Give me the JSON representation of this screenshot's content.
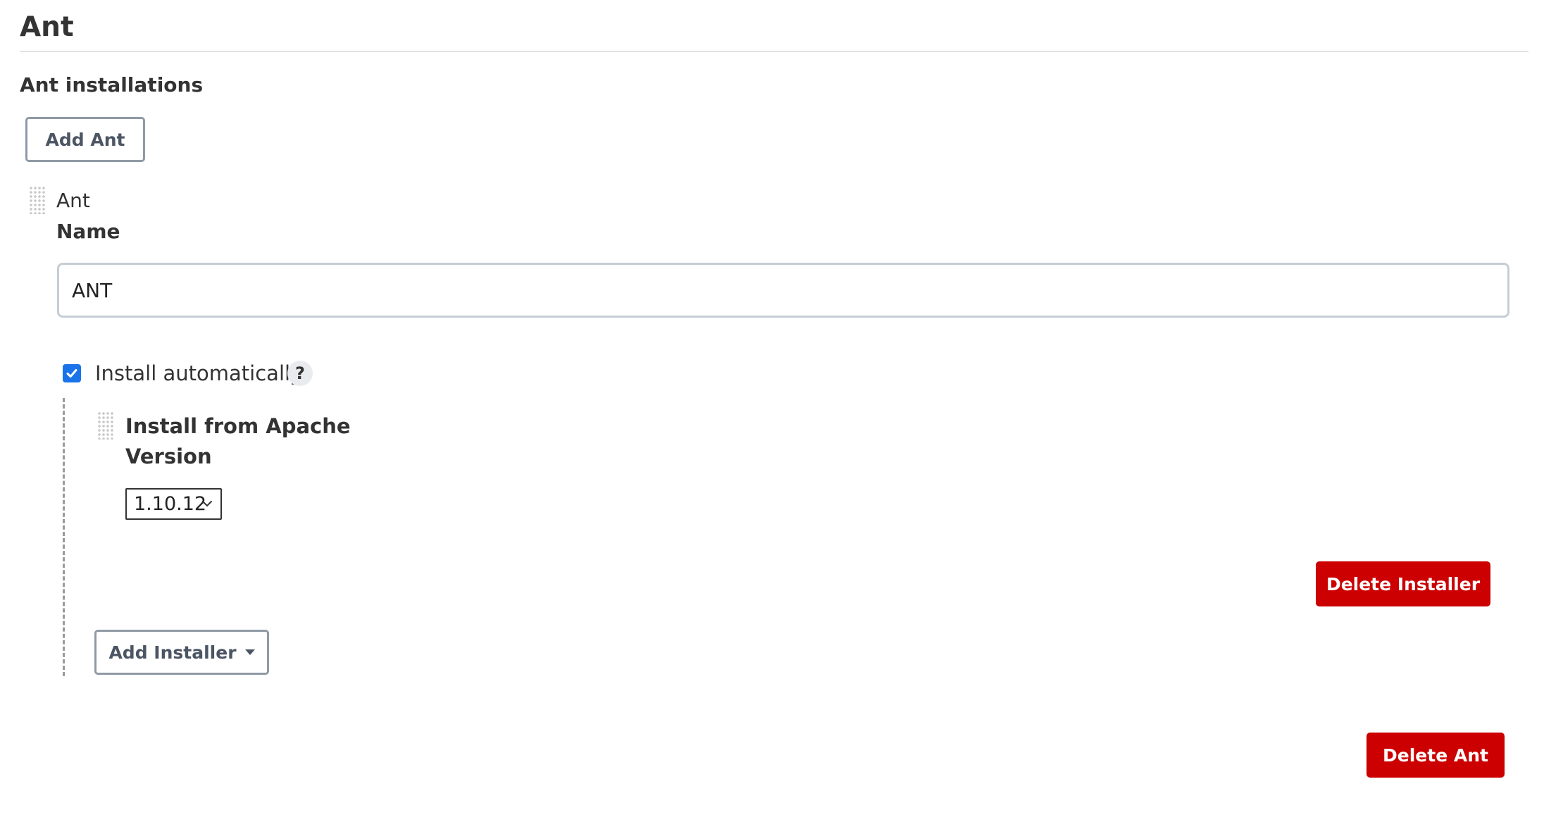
{
  "section": {
    "title": "Ant",
    "installations_label": "Ant installations",
    "add_ant_label": "Add Ant"
  },
  "ant_item": {
    "header": "Ant",
    "name_label": "Name",
    "name_value": "ANT",
    "install_automatically": {
      "label": "Install automatically",
      "checked": true,
      "help_glyph": "?"
    },
    "installer": {
      "title": "Install from Apache",
      "version_label": "Version",
      "version_selected": "1.10.12",
      "delete_label": "Delete Installer"
    },
    "add_installer_label": "Add Installer",
    "delete_label": "Delete Ant"
  },
  "colors": {
    "danger": "#cc0000",
    "checkbox_accent": "#1a73e8",
    "secondary_border": "#8f9aa6"
  },
  "icons": [
    "drag-handle-icon",
    "checkmark-icon",
    "help-icon",
    "chevron-down-icon",
    "caret-down-icon"
  ]
}
